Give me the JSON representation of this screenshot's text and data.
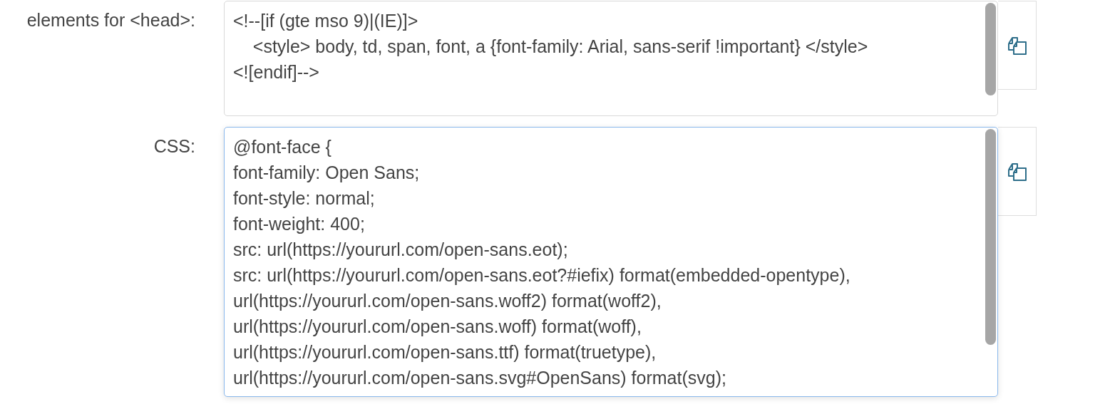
{
  "fields": [
    {
      "label": "elements for <head>:",
      "focused": false,
      "lines": [
        "<!--[if (gte mso 9)|(IE)]>",
        "    <style> body, td, span, font, a {font-family: Arial, sans-serif !important} </style>",
        "<![endif]-->"
      ]
    },
    {
      "label": "CSS:",
      "focused": true,
      "lines": [
        "@font-face {",
        "font-family: Open Sans;",
        "font-style: normal;",
        "font-weight: 400;",
        "src: url(https://yoururl.com/open-sans.eot);",
        "src: url(https://yoururl.com/open-sans.eot?#iefix) format(embedded-opentype),",
        "url(https://yoururl.com/open-sans.woff2) format(woff2),",
        "url(https://yoururl.com/open-sans.woff) format(woff),",
        "url(https://yoururl.com/open-sans.ttf) format(truetype),",
        "url(https://yoururl.com/open-sans.svg#OpenSans) format(svg);"
      ]
    }
  ]
}
